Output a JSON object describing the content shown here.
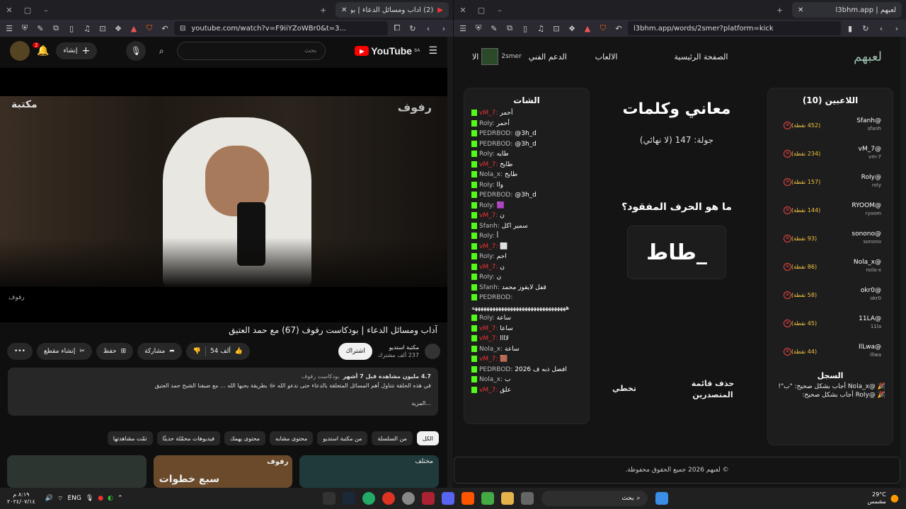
{
  "left_window": {
    "tab_title": "(2) آداب ومسائل الدعاء | بودكاست",
    "url": "youtube.com/watch?v=F9iiYZoWBr0&t=3...",
    "yt": {
      "logo": "YouTube",
      "logo_sup": "SA",
      "search_placeholder": "بحث",
      "create": "إنشاء",
      "notif_count": "2",
      "video_overlay_brand": "رفوف",
      "video_overlay_library": "مكتبة",
      "video_watermark": "رفوف",
      "title": "آداب ومسائل الدعاء | بودكاست رفوف (67) مع حمد العتيق",
      "channel": "مكتبة استديو",
      "subscribers": "237 ألف مشترك",
      "subscribe": "اشتراك",
      "likes": "54 ألف",
      "share": "مشاركة",
      "save": "حفظ",
      "clip": "إنشاء مقطع",
      "desc_stats": "4.7 مليون مشاهدة  قبل 7 أشهر",
      "desc_tag": "بودكاست رفوف",
      "desc_text": "في هذه الحلقة نتناول أهم المسائل المتعلقة بالدعاء حتى ندعو الله ﷻ بطريقة يحبها الله ... مع ضيفنا الشيخ حمد العتيق",
      "desc_more": "...المزيد",
      "chips": [
        "الكل",
        "من السلسلة",
        "من مكتبة استديو",
        "محتوى مشابه",
        "محتوى يهمك",
        "فيديوهات محمّلة حديثًا",
        "تمّت مشاهدتها"
      ],
      "thumb_texts": [
        "مختلف",
        "رفوف",
        "سبع خطوات"
      ]
    }
  },
  "right_window": {
    "tab_title": "لعبهم | l3bhm.app",
    "url": "l3bhm.app/words/2smer?platform=kick",
    "site": {
      "brand": "لعبهم",
      "nav": [
        "الصفحة الرئيسية",
        "الالعاب",
        "الدعم الفني",
        "الا"
      ],
      "user": "2smer",
      "players_title": "اللاعبين (10)",
      "players": [
        {
          "name": "@Sfanh",
          "sub": "sfanh",
          "pts": "(452 نقطة)"
        },
        {
          "name": "@vM_7",
          "sub": "vm-7",
          "pts": "(234 نقطة)"
        },
        {
          "name": "@RoIy",
          "sub": "roly",
          "pts": "(157 نقطة)"
        },
        {
          "name": "@RYOOM",
          "sub": "ryoom",
          "pts": "(144 نقطة)"
        },
        {
          "name": "@sonono",
          "sub": "sonono",
          "pts": "(93 نقطة)"
        },
        {
          "name": "@Nola_x",
          "sub": "nola-x",
          "pts": "(86 نقطة)"
        },
        {
          "name": "@okr0",
          "sub": "okr0",
          "pts": "(58 نقطة)"
        },
        {
          "name": "@11LA",
          "sub": "11la",
          "pts": "(45 نقطة)"
        },
        {
          "name": "@IlLwa",
          "sub": "illwa",
          "pts": "(44 نقطة)"
        }
      ],
      "log_title": "السجل",
      "log": [
        "🎉 @Nola_x أجاب بشكل صحيح: \"ب\"!",
        "🎉 @RoIy أجاب بشكل صحيح:"
      ],
      "game_title": "معاني وكلمات",
      "round": "جولة: 147 (لا نهائي)",
      "question": "ما هو الحرف المفقود؟",
      "word": "_طاط",
      "btn_leaderboard": "حذف قائمة المتصدرين",
      "btn_skip": "تخطي",
      "chat_title": "الشات",
      "chat": [
        {
          "u": "vM_7:",
          "t": "أحمر",
          "r": true
        },
        {
          "u": "RoIy:",
          "t": "أحمر",
          "r": false
        },
        {
          "u": "PEDRBOD:",
          "t": "@3h_d",
          "r": false
        },
        {
          "u": "PEDRBOD:",
          "t": "@3h_d",
          "r": false
        },
        {
          "u": "RoIy:",
          "t": "طايه",
          "r": false
        },
        {
          "u": "vM_7:",
          "t": "طايخ",
          "r": true
        },
        {
          "u": "Nola_x:",
          "t": "طايخ",
          "r": false
        },
        {
          "u": "RoIy:",
          "t": "واا",
          "r": false
        },
        {
          "u": "PEDRBOD:",
          "t": "@3h_d",
          "r": false
        },
        {
          "u": "RoIy:",
          "t": "🟪",
          "r": false
        },
        {
          "u": "vM_7:",
          "t": "ن",
          "r": true
        },
        {
          "u": "Sfanh:",
          "t": "سمير اكل",
          "r": false
        },
        {
          "u": "RoIy:",
          "t": "أ",
          "r": false
        },
        {
          "u": "vM_7:",
          "t": "⬜",
          "r": true
        },
        {
          "u": "RoIy:",
          "t": "احم",
          "r": false
        },
        {
          "u": "vM_7:",
          "t": "ن",
          "r": true
        },
        {
          "u": "RoIy:",
          "t": "ن",
          "r": false
        },
        {
          "u": "Sfanh:",
          "t": "قفل لايقوز محمد",
          "r": false
        },
        {
          "u": "PEDRBOD:",
          "t": "",
          "r": false
        },
        {
          "u": "",
          "t": "ههههههههههههههههههههههههههههههههه",
          "r": false
        },
        {
          "u": "RoIy:",
          "t": "ساعة",
          "r": false
        },
        {
          "u": "vM_7:",
          "t": "ساعا",
          "r": true
        },
        {
          "u": "vM_7:",
          "t": "لاااا",
          "r": true
        },
        {
          "u": "Nola_x:",
          "t": "ساعة",
          "r": false
        },
        {
          "u": "vM_7:",
          "t": "🟫",
          "r": true
        },
        {
          "u": "PEDRBOD:",
          "t": "افضل ذبه ف 2026",
          "r": false
        },
        {
          "u": "Nola_x:",
          "t": "ب",
          "r": false
        },
        {
          "u": "vM_7:",
          "t": "علق",
          "r": true
        }
      ],
      "footer": "© لعبهم 2026 جميع الحقوق محفوظة."
    }
  },
  "taskbar": {
    "search": "بحث",
    "lang": "ENG",
    "time": "٨:١٩ م",
    "date": "٢٠٢٤/٠٧/١٤",
    "weather": "29°C",
    "weather_desc": "مشمس"
  }
}
